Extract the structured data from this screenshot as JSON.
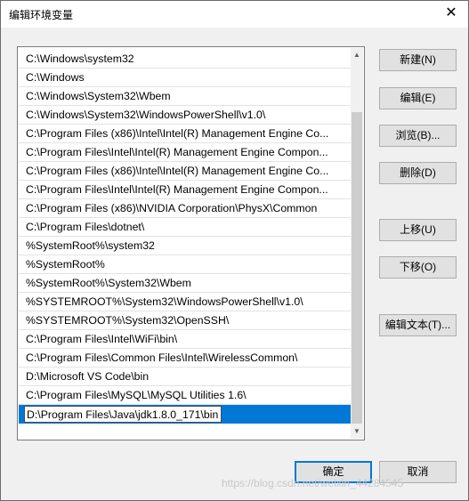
{
  "window": {
    "title": "编辑环境变量",
    "close_symbol": "✕"
  },
  "paths": [
    "C:\\Windows\\system32",
    "C:\\Windows",
    "C:\\Windows\\System32\\Wbem",
    "C:\\Windows\\System32\\WindowsPowerShell\\v1.0\\",
    "C:\\Program Files (x86)\\Intel\\Intel(R) Management Engine Co...",
    "C:\\Program Files\\Intel\\Intel(R) Management Engine Compon...",
    "C:\\Program Files (x86)\\Intel\\Intel(R) Management Engine Co...",
    "C:\\Program Files\\Intel\\Intel(R) Management Engine Compon...",
    "C:\\Program Files (x86)\\NVIDIA Corporation\\PhysX\\Common",
    "C:\\Program Files\\dotnet\\",
    "%SystemRoot%\\system32",
    "%SystemRoot%",
    "%SystemRoot%\\System32\\Wbem",
    "%SYSTEMROOT%\\System32\\WindowsPowerShell\\v1.0\\",
    "%SYSTEMROOT%\\System32\\OpenSSH\\",
    "C:\\Program Files\\Intel\\WiFi\\bin\\",
    "C:\\Program Files\\Common Files\\Intel\\WirelessCommon\\",
    "D:\\Microsoft VS Code\\bin",
    "C:\\Program Files\\MySQL\\MySQL Utilities 1.6\\"
  ],
  "editing_value": "D:\\Program Files\\Java\\jdk1.8.0_171\\bin",
  "buttons": {
    "new": "新建(N)",
    "edit": "编辑(E)",
    "browse": "浏览(B)...",
    "delete": "删除(D)",
    "move_up": "上移(U)",
    "move_down": "下移(O)",
    "edit_text": "编辑文本(T)...",
    "ok": "确定",
    "cancel": "取消"
  },
  "watermark": "https://blog.csdn.net/weixin_44284545",
  "colors": {
    "selection": "#0078d7",
    "default_button_border": "#0078d7"
  }
}
